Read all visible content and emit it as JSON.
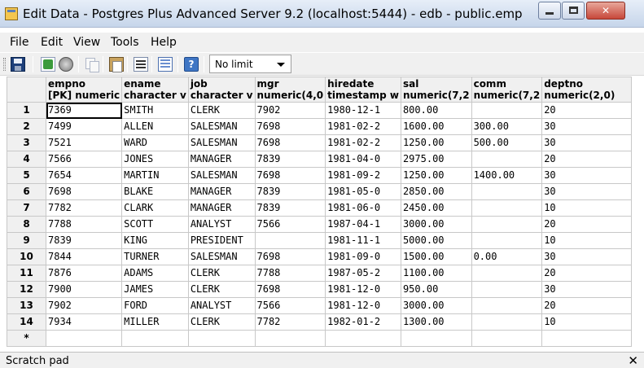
{
  "window": {
    "title": "Edit Data - Postgres Plus Advanced Server 9.2 (localhost:5444) - edb - public.emp",
    "close_glyph": "✕"
  },
  "menu": [
    "File",
    "Edit",
    "View",
    "Tools",
    "Help"
  ],
  "toolbar": {
    "icons": [
      "save-icon",
      "refresh-icon",
      "stop-icon",
      "copy-icon",
      "paste-icon",
      "delete-icon",
      "filter-icon",
      "help-icon"
    ],
    "help_glyph": "?",
    "limit": "No limit"
  },
  "grid": {
    "columns": [
      {
        "name": "empno",
        "type": "[PK] numeric"
      },
      {
        "name": "ename",
        "type": "character v"
      },
      {
        "name": "job",
        "type": "character v"
      },
      {
        "name": "mgr",
        "type": "numeric(4,0"
      },
      {
        "name": "hiredate",
        "type": "timestamp w"
      },
      {
        "name": "sal",
        "type": "numeric(7,2"
      },
      {
        "name": "comm",
        "type": "numeric(7,2"
      },
      {
        "name": "deptno",
        "type": "numeric(2,0)"
      }
    ],
    "rows": [
      {
        "num": "1",
        "cells": [
          "7369",
          "SMITH",
          "CLERK",
          "7902",
          "1980-12-1",
          "800.00",
          "",
          "20"
        ]
      },
      {
        "num": "2",
        "cells": [
          "7499",
          "ALLEN",
          "SALESMAN",
          "7698",
          "1981-02-2",
          "1600.00",
          "300.00",
          "30"
        ]
      },
      {
        "num": "3",
        "cells": [
          "7521",
          "WARD",
          "SALESMAN",
          "7698",
          "1981-02-2",
          "1250.00",
          "500.00",
          "30"
        ]
      },
      {
        "num": "4",
        "cells": [
          "7566",
          "JONES",
          "MANAGER",
          "7839",
          "1981-04-0",
          "2975.00",
          "",
          "20"
        ]
      },
      {
        "num": "5",
        "cells": [
          "7654",
          "MARTIN",
          "SALESMAN",
          "7698",
          "1981-09-2",
          "1250.00",
          "1400.00",
          "30"
        ]
      },
      {
        "num": "6",
        "cells": [
          "7698",
          "BLAKE",
          "MANAGER",
          "7839",
          "1981-05-0",
          "2850.00",
          "",
          "30"
        ]
      },
      {
        "num": "7",
        "cells": [
          "7782",
          "CLARK",
          "MANAGER",
          "7839",
          "1981-06-0",
          "2450.00",
          "",
          "10"
        ]
      },
      {
        "num": "8",
        "cells": [
          "7788",
          "SCOTT",
          "ANALYST",
          "7566",
          "1987-04-1",
          "3000.00",
          "",
          "20"
        ]
      },
      {
        "num": "9",
        "cells": [
          "7839",
          "KING",
          "PRESIDENT",
          "",
          "1981-11-1",
          "5000.00",
          "",
          "10"
        ]
      },
      {
        "num": "10",
        "cells": [
          "7844",
          "TURNER",
          "SALESMAN",
          "7698",
          "1981-09-0",
          "1500.00",
          "0.00",
          "30"
        ]
      },
      {
        "num": "11",
        "cells": [
          "7876",
          "ADAMS",
          "CLERK",
          "7788",
          "1987-05-2",
          "1100.00",
          "",
          "20"
        ]
      },
      {
        "num": "12",
        "cells": [
          "7900",
          "JAMES",
          "CLERK",
          "7698",
          "1981-12-0",
          "950.00",
          "",
          "30"
        ]
      },
      {
        "num": "13",
        "cells": [
          "7902",
          "FORD",
          "ANALYST",
          "7566",
          "1981-12-0",
          "3000.00",
          "",
          "20"
        ]
      },
      {
        "num": "14",
        "cells": [
          "7934",
          "MILLER",
          "CLERK",
          "7782",
          "1982-01-2",
          "1300.00",
          "",
          "10"
        ]
      }
    ],
    "new_row_marker": "*"
  },
  "scratch_pad": {
    "label": "Scratch pad",
    "close_glyph": "✕"
  }
}
